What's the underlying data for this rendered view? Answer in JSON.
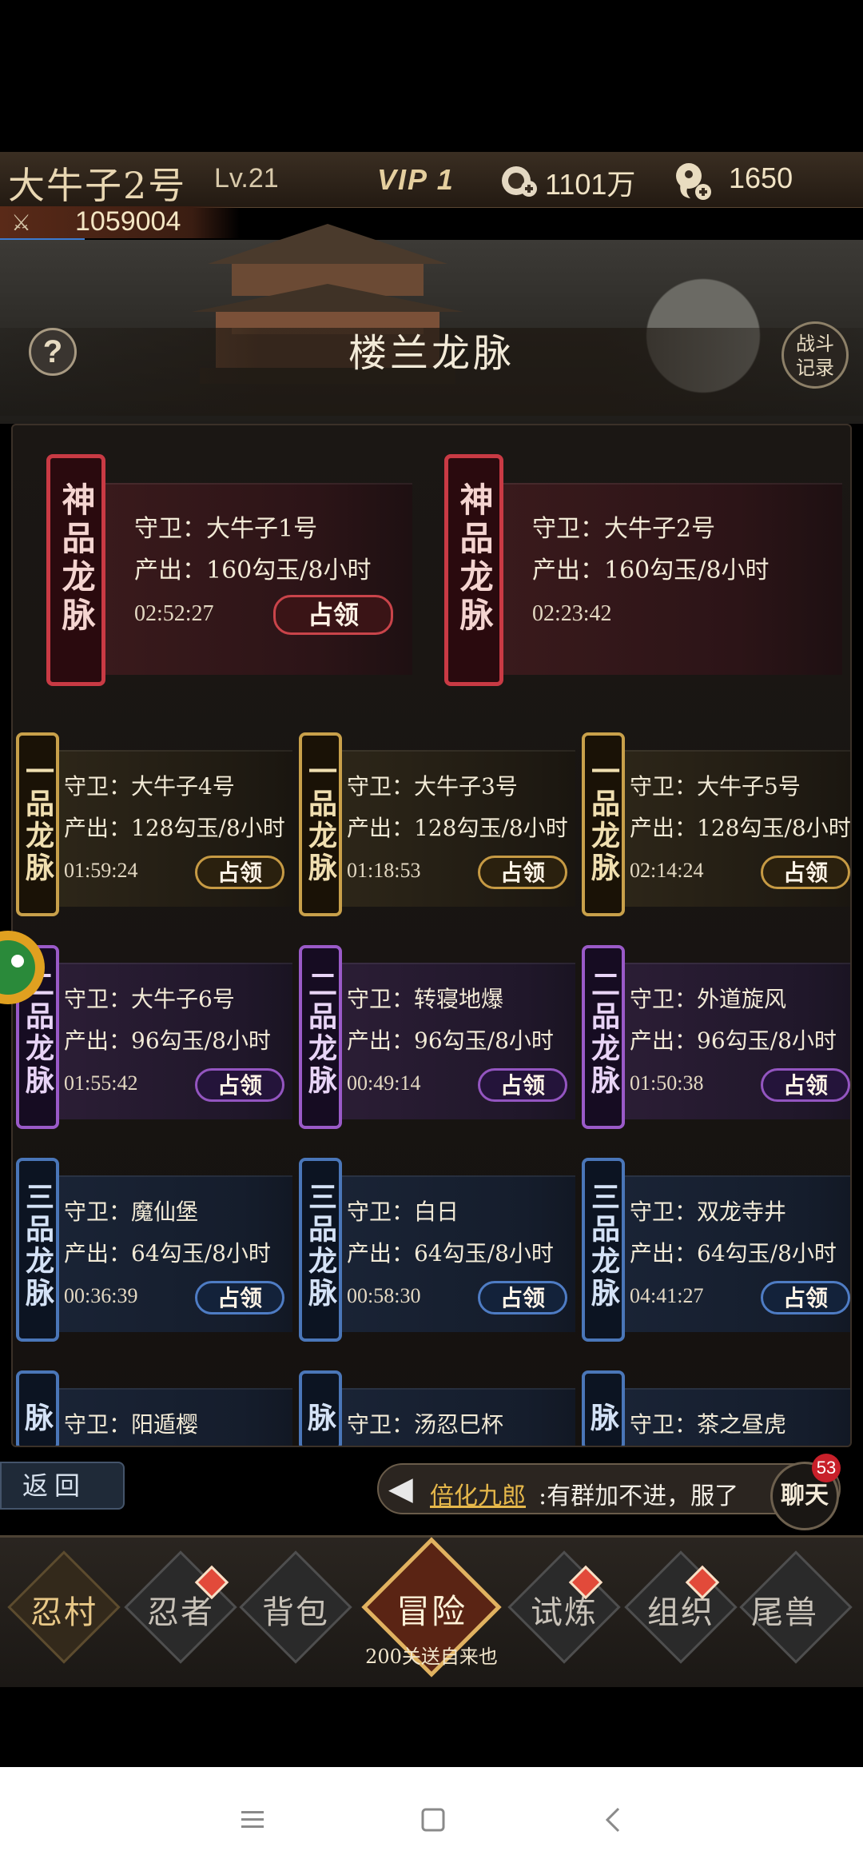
{
  "header": {
    "player_name": "大牛子2号",
    "level": "Lv.21",
    "vip": "VIP 1",
    "coins": "1101万",
    "gems": "1650",
    "power": "1059004"
  },
  "page": {
    "title": "楼兰龙脉",
    "help": "?",
    "battle_record": "战斗记录",
    "battle_record_line1": "战斗",
    "battle_record_line2": "记录"
  },
  "veins": {
    "divine": [
      {
        "rank": "神品龙脉",
        "guard": "守卫：大牛子1号",
        "output": "产出：160勾玉/8小时",
        "timer": "02:52:27",
        "button": "占领"
      },
      {
        "rank": "神品龙脉",
        "guard": "守卫：大牛子2号",
        "output": "产出：160勾玉/8小时",
        "timer": "02:23:42",
        "button": ""
      }
    ],
    "grade1": [
      {
        "rank": "一品龙脉",
        "guard": "守卫：大牛子4号",
        "output": "产出：128勾玉/8小时",
        "timer": "01:59:24",
        "button": "占领"
      },
      {
        "rank": "一品龙脉",
        "guard": "守卫：大牛子3号",
        "output": "产出：128勾玉/8小时",
        "timer": "01:18:53",
        "button": "占领"
      },
      {
        "rank": "一品龙脉",
        "guard": "守卫：大牛子5号",
        "output": "产出：128勾玉/8小时",
        "timer": "02:14:24",
        "button": "占领"
      }
    ],
    "grade2": [
      {
        "rank": "二品龙脉",
        "guard": "守卫：大牛子6号",
        "output": "产出：96勾玉/8小时",
        "timer": "01:55:42",
        "button": "占领"
      },
      {
        "rank": "二品龙脉",
        "guard": "守卫：转寝地爆",
        "output": "产出：96勾玉/8小时",
        "timer": "00:49:14",
        "button": "占领"
      },
      {
        "rank": "二品龙脉",
        "guard": "守卫：外道旋风",
        "output": "产出：96勾玉/8小时",
        "timer": "01:50:38",
        "button": "占领"
      }
    ],
    "grade3": [
      {
        "rank": "三品龙脉",
        "guard": "守卫：魔仙堡",
        "output": "产出：64勾玉/8小时",
        "timer": "00:36:39",
        "button": "占领"
      },
      {
        "rank": "三品龙脉",
        "guard": "守卫：白日",
        "output": "产出：64勾玉/8小时",
        "timer": "00:58:30",
        "button": "占领"
      },
      {
        "rank": "三品龙脉",
        "guard": "守卫：双龙寺井",
        "output": "产出：64勾玉/8小时",
        "timer": "04:41:27",
        "button": "占领"
      }
    ],
    "grade3_next": [
      {
        "rank": "三品龙脉",
        "guard": "守卫：阳遁樱"
      },
      {
        "rank": "三品龙脉",
        "guard": "守卫：汤忍巳杯"
      },
      {
        "rank": "三品龙脉",
        "guard": "守卫：茶之昼虎"
      }
    ]
  },
  "chat": {
    "back": "返回",
    "sender": "倍化九郎",
    "message": ":有群加不进，服了",
    "button": "聊天",
    "badge": "53"
  },
  "nav": {
    "items": [
      "忍村",
      "忍者",
      "背包",
      "冒险",
      "试炼",
      "组织",
      "尾兽"
    ],
    "adventure_sub": "200关送自来也"
  },
  "colors": {
    "divine": "#c93a44",
    "grade1": "#c8a04a",
    "grade2": "#9a5ac8",
    "grade3": "#4a76b8",
    "chat_sender": "#e6b84a"
  }
}
